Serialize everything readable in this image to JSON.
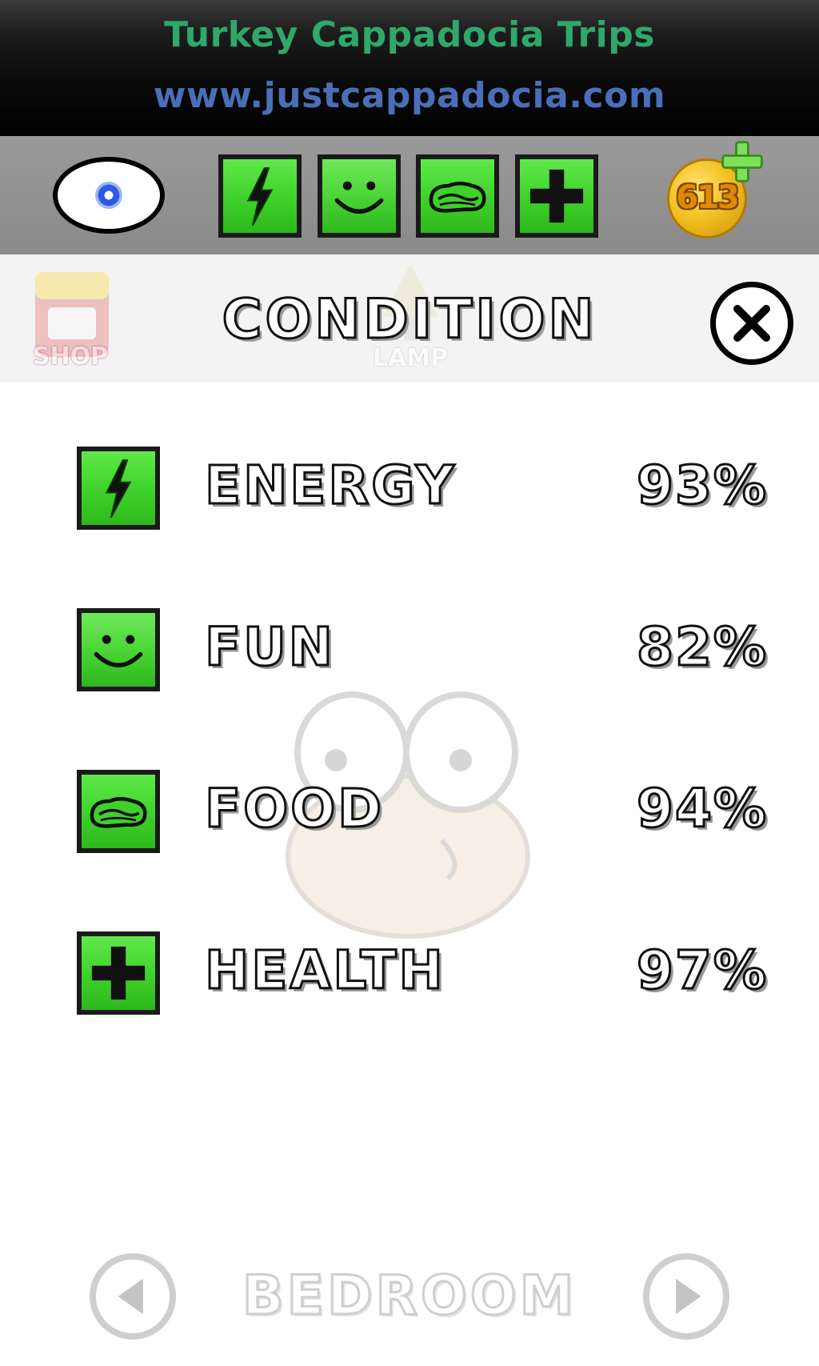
{
  "ad": {
    "title": "Turkey Cappadocia Trips",
    "url": "www.justcappadocia.com",
    "title_color": "#2fa86a",
    "url_color": "#4a6fb8"
  },
  "status_bar": {
    "eye_icon": "eye-icon",
    "stats": [
      {
        "name": "energy",
        "icon": "lightning-icon"
      },
      {
        "name": "fun",
        "icon": "smiley-icon"
      },
      {
        "name": "food",
        "icon": "food-icon"
      },
      {
        "name": "health",
        "icon": "plus-icon"
      }
    ],
    "coins": "613",
    "accent_color": "#3ed12a"
  },
  "header": {
    "shop_label": "SHOP",
    "lamp_label": "LAMP",
    "title": "CONDITION",
    "close_icon": "close-icon"
  },
  "conditions": [
    {
      "label": "ENERGY",
      "value": "93%",
      "icon": "lightning-icon"
    },
    {
      "label": "FUN",
      "value": "82%",
      "icon": "smiley-icon"
    },
    {
      "label": "FOOD",
      "value": "94%",
      "icon": "food-icon"
    },
    {
      "label": "HEALTH",
      "value": "97%",
      "icon": "plus-icon"
    }
  ],
  "bottom_nav": {
    "room": "BEDROOM",
    "prev_icon": "arrow-left-icon",
    "next_icon": "arrow-right-icon"
  }
}
